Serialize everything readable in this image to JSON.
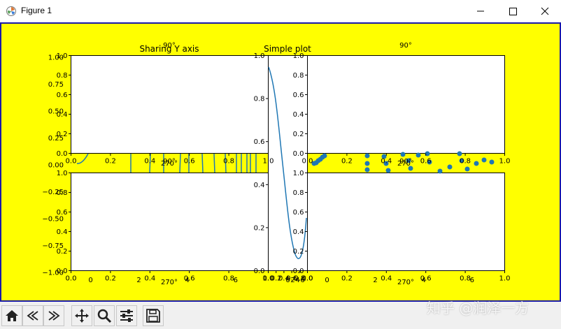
{
  "window": {
    "title": "Figure 1",
    "icon": "matplotlib-icon"
  },
  "colors": {
    "figure_bg": "#ffff00",
    "frame": "#1a1aa8",
    "series": "#1f77b4",
    "titlebar": "#ffffff"
  },
  "toolbar": {
    "buttons": [
      {
        "name": "home-button",
        "icon": "home-icon"
      },
      {
        "name": "back-button",
        "icon": "back-arrow-icon"
      },
      {
        "name": "forward-button",
        "icon": "forward-arrow-icon"
      },
      {
        "name": "pan-button",
        "icon": "move-icon"
      },
      {
        "name": "zoom-button",
        "icon": "zoom-icon"
      },
      {
        "name": "configure-button",
        "icon": "sliders-icon"
      },
      {
        "name": "save-button",
        "icon": "save-icon"
      }
    ]
  },
  "watermark": "知乎 @润泽一方",
  "chart_data": [
    {
      "type": "line",
      "projection": "polar",
      "title": "Sharing Y axis",
      "theta_label_top": "90°",
      "theta_label_bottom": "270°",
      "note": "polar axes overlapping a cartesian grid; tick labels from both drawn",
      "x_ticks": [
        "0.0",
        "0.2",
        "0.4",
        "0.6",
        "0.8",
        "1.0"
      ],
      "y_ticks": [
        "0.0",
        "0.2",
        "0.4",
        "0.6",
        "0.8",
        "1.0"
      ],
      "extra_ticks_left": [
        "1.00",
        "0.75",
        "0.50",
        "0.25",
        "0.00",
        "−0.25",
        "−0.50",
        "−0.75",
        "−1.00"
      ],
      "extra_ticks_bottom": [
        "0",
        "2",
        "4",
        "6"
      ]
    },
    {
      "type": "line",
      "title": "Simple plot",
      "x_ticks": [
        "0.0",
        "0.2",
        "0.4",
        "0.6",
        "0.8",
        "1.0"
      ],
      "y_ticks": [
        "0.0",
        "0.2",
        "0.4",
        "0.6",
        "0.8",
        "1.0"
      ],
      "extra_ticks_bottom": [
        "0",
        "2",
        "4",
        "6"
      ]
    },
    {
      "type": "scatter",
      "projection": "polar",
      "theta_label_top": "90°",
      "theta_label_bottom": "270°",
      "x_ticks": [
        "0.0",
        "0.2",
        "0.4",
        "0.6",
        "0.8",
        "1.0"
      ],
      "y_ticks": [
        "0.0",
        "0.2",
        "0.4",
        "0.6",
        "0.8",
        "1.0"
      ],
      "extra_ticks_bottom": [
        "0",
        "2",
        "4",
        "6"
      ]
    },
    {
      "type": "scatter",
      "projection": "polar",
      "theta_label_top": "90°",
      "theta_label_bottom": "270°",
      "x_ticks": [
        "0.0",
        "0.2",
        "0.4",
        "0.6",
        "0.8",
        "1.0"
      ],
      "y_ticks": [
        "0.0",
        "0.2",
        "0.4",
        "0.6",
        "0.8",
        "1.0"
      ],
      "extra_ticks_bottom": [
        "0",
        "2",
        "4",
        "6"
      ]
    }
  ]
}
